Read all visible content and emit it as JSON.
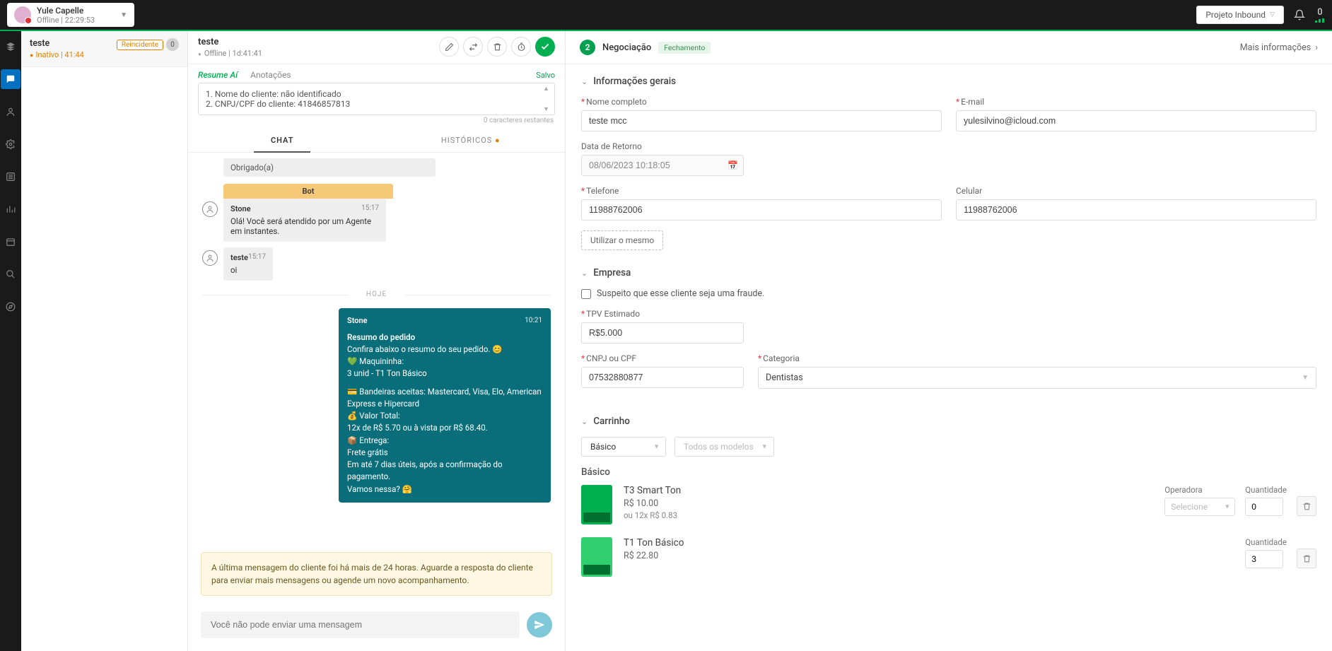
{
  "top": {
    "user_name": "Yule Capelle",
    "user_status": "Offline | 22:29:53",
    "project_btn": "Projeto Inbound",
    "online_count": "0"
  },
  "convo": {
    "title": "teste",
    "sub": "Inativo | 41:44",
    "badge_reinc": "Reincidente",
    "badge_count": "0"
  },
  "chat": {
    "title": "teste",
    "sub": "Offline | 1d:41:41",
    "tabs": {
      "resume": "Resume Aí",
      "anot": "Anotações",
      "saved": "Salvo"
    },
    "notes_line1": "1. Nome do cliente: não identificado",
    "notes_line2": "2. CNPJ/CPF do cliente: 41846857813",
    "chars": "0 caracteres restantes",
    "tab_chat": "CHAT",
    "tab_hist": "HISTÓRICOS",
    "thanks": "Obrigado(a)",
    "bot_label": "Bot",
    "m1_sender": "Stone",
    "m1_time": "15:17",
    "m1_text": "Olá! Você será atendido por um Agente em instantes.",
    "m2_sender": "teste",
    "m2_time": "15:17",
    "m2_text": "oi",
    "day": "HOJE",
    "m3_sender": "Stone",
    "m3_time": "10:21",
    "m3_l1": "Resumo do pedido",
    "m3_l2": "Confira abaixo o resumo do seu pedido. 😊",
    "m3_l3": "💚 Maquininha:",
    "m3_l4": "3 unid - T1 Ton Básico",
    "m3_l5": "💳 Bandeiras aceitas: Mastercard, Visa, Elo, American Express e Hipercard",
    "m3_l6": "💰 Valor Total:",
    "m3_l7": "12x de R$ 5.70 ou à vista por R$ 68.40.",
    "m3_l8": "📦 Entrega:",
    "m3_l9": "Frete grátis",
    "m3_l10": "Em até 7 dias úteis, após a confirmação do pagamento.",
    "m3_l11": "Vamos nessa? 🤗",
    "warning": "A última mensagem do cliente foi há mais de 24 horas. Aguarde a resposta do cliente para enviar mais mensagens ou agende um novo acompanhamento.",
    "input_ph": "Você não pode enviar uma mensagem"
  },
  "panel": {
    "step": "2",
    "stage": "Negociação",
    "tag": "Fechamento",
    "more": "Mais informações",
    "sec_info": "Informações gerais",
    "lbl_nome": "Nome completo",
    "val_nome": "teste mcc",
    "lbl_email": "E-mail",
    "val_email": "yulesilvino@icloud.com",
    "lbl_data": "Data de Retorno",
    "val_data": "08/06/2023 10:18:05",
    "lbl_tel": "Telefone",
    "val_tel": "11988762006",
    "lbl_cel": "Celular",
    "val_cel": "11988762006",
    "btn_same": "Utilizar o mesmo",
    "sec_emp": "Empresa",
    "chk_fraud": "Suspeito que esse cliente seja uma fraude.",
    "lbl_tpv": "TPV Estimado",
    "val_tpv": "R$5.000",
    "lbl_cnpj": "CNPJ ou CPF",
    "val_cnpj": "07532880877",
    "lbl_cat": "Categoria",
    "val_cat": "Dentistas",
    "sec_cart": "Carrinho",
    "filter1": "Básico",
    "filter2": "Todos os modelos",
    "cart_group": "Básico",
    "p1_name": "T3 Smart Ton",
    "p1_price": "R$ 10.00",
    "p1_inst": "ou 12x R$ 0.83",
    "lbl_oper": "Operadora",
    "ph_oper": "Selecione",
    "lbl_qty": "Quantidade",
    "p1_qty": "0",
    "p2_name": "T1 Ton Básico",
    "p2_price": "R$ 22.80",
    "p2_qty": "3"
  }
}
